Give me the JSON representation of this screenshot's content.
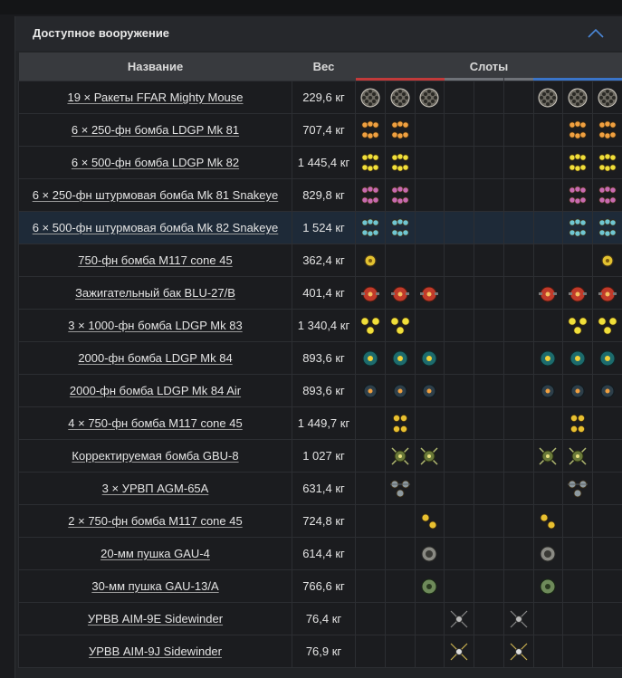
{
  "panel": {
    "title": "Доступное вооружение",
    "collapse_icon": "chevron-up-icon"
  },
  "table": {
    "headers": {
      "name": "Название",
      "weight": "Вес",
      "slots": "Слоты"
    },
    "slot_bar_colors": [
      "#c23a3a",
      "#c23a3a",
      "#c23a3a",
      "#6f7278",
      "#6f7278",
      "#6f7278",
      "#3a74c9",
      "#3a74c9",
      "#3a74c9"
    ],
    "rows": [
      {
        "name": "19 × Ракеты FFAR Mighty Mouse",
        "weight": "229,6 кг",
        "slots": [
          "rocket-pod",
          "rocket-pod",
          "rocket-pod",
          "",
          "",
          "",
          "rocket-pod",
          "rocket-pod",
          "rocket-pod"
        ]
      },
      {
        "name": "6 × 250-фн бомба LDGP Mk 81",
        "weight": "707,4 кг",
        "slots": [
          "bomb-cluster-orange",
          "bomb-cluster-orange",
          "",
          "",
          "",
          "",
          "",
          "bomb-cluster-orange",
          "bomb-cluster-orange"
        ]
      },
      {
        "name": "6 × 500-фн бомба LDGP Mk 82",
        "weight": "1 445,4 кг",
        "slots": [
          "bomb-cluster-yellow",
          "bomb-cluster-yellow",
          "",
          "",
          "",
          "",
          "",
          "bomb-cluster-yellow",
          "bomb-cluster-yellow"
        ]
      },
      {
        "name": "6 × 250-фн штурмовая бомба Mk 81 Snakeye",
        "weight": "829,8 кг",
        "slots": [
          "bomb-cluster-purple",
          "bomb-cluster-purple",
          "",
          "",
          "",
          "",
          "",
          "bomb-cluster-purple",
          "bomb-cluster-purple"
        ]
      },
      {
        "name": "6 × 500-фн штурмовая бомба Mk 82 Snakeye",
        "weight": "1 524 кг",
        "selected": true,
        "slots": [
          "bomb-cluster-teal",
          "bomb-cluster-teal",
          "",
          "",
          "",
          "",
          "",
          "bomb-cluster-teal",
          "bomb-cluster-teal"
        ]
      },
      {
        "name": "750-фн бомба M117 cone 45",
        "weight": "362,4 кг",
        "slots": [
          "bomb-single-yellow",
          "",
          "",
          "",
          "",
          "",
          "",
          "",
          "bomb-single-yellow"
        ]
      },
      {
        "name": "Зажигательный бак BLU-27/B",
        "weight": "401,4 кг",
        "slots": [
          "fire-tank",
          "fire-tank",
          "fire-tank",
          "",
          "",
          "",
          "fire-tank",
          "fire-tank",
          "fire-tank"
        ]
      },
      {
        "name": "3 × 1000-фн бомба LDGP Mk 83",
        "weight": "1 340,4 кг",
        "slots": [
          "bomb-triple-yellow",
          "bomb-triple-yellow",
          "",
          "",
          "",
          "",
          "",
          "bomb-triple-yellow",
          "bomb-triple-yellow"
        ]
      },
      {
        "name": "2000-фн бомба LDGP Mk 84",
        "weight": "893,6 кг",
        "slots": [
          "bomb-big-teal",
          "bomb-big-teal",
          "bomb-big-teal",
          "",
          "",
          "",
          "bomb-big-teal",
          "bomb-big-teal",
          "bomb-big-teal"
        ]
      },
      {
        "name": "2000-фн бомба LDGP Mk 84 Air",
        "weight": "893,6 кг",
        "slots": [
          "bomb-air",
          "bomb-air",
          "bomb-air",
          "",
          "",
          "",
          "bomb-air",
          "bomb-air",
          "bomb-air"
        ]
      },
      {
        "name": "4 × 750-фн бомба M117 cone 45",
        "weight": "1 449,7 кг",
        "slots": [
          "",
          "bomb-quad-yellow",
          "",
          "",
          "",
          "",
          "",
          "bomb-quad-yellow",
          ""
        ]
      },
      {
        "name": "Корректируемая бомба GBU-8",
        "weight": "1 027 кг",
        "slots": [
          "",
          "guided-bomb",
          "guided-bomb",
          "",
          "",
          "",
          "guided-bomb",
          "guided-bomb",
          ""
        ]
      },
      {
        "name": "3 × УРВП AGM-65A",
        "weight": "631,4 кг",
        "slots": [
          "",
          "missile-triple",
          "",
          "",
          "",
          "",
          "",
          "missile-triple",
          ""
        ]
      },
      {
        "name": "2 × 750-фн бомба M117 cone 45",
        "weight": "724,8 кг",
        "slots": [
          "",
          "",
          "bomb-double-yellow",
          "",
          "",
          "",
          "bomb-double-yellow",
          "",
          ""
        ]
      },
      {
        "name": "20-мм пушка GAU-4",
        "weight": "614,4 кг",
        "slots": [
          "",
          "",
          "gun-pod-grey",
          "",
          "",
          "",
          "gun-pod-grey",
          "",
          ""
        ]
      },
      {
        "name": "30-мм пушка GAU-13/A",
        "weight": "766,6 кг",
        "slots": [
          "",
          "",
          "gun-pod-green",
          "",
          "",
          "",
          "gun-pod-green",
          "",
          ""
        ]
      },
      {
        "name": "УРВВ AIM-9E Sidewinder",
        "weight": "76,4 кг",
        "slots": [
          "",
          "",
          "",
          "aam-missile",
          "",
          "aam-missile",
          "",
          "",
          ""
        ]
      },
      {
        "name": "УРВВ AIM-9J Sidewinder",
        "weight": "76,9 кг",
        "slots": [
          "",
          "",
          "",
          "aam-missile-y",
          "",
          "aam-missile-y",
          "",
          "",
          ""
        ]
      }
    ]
  }
}
